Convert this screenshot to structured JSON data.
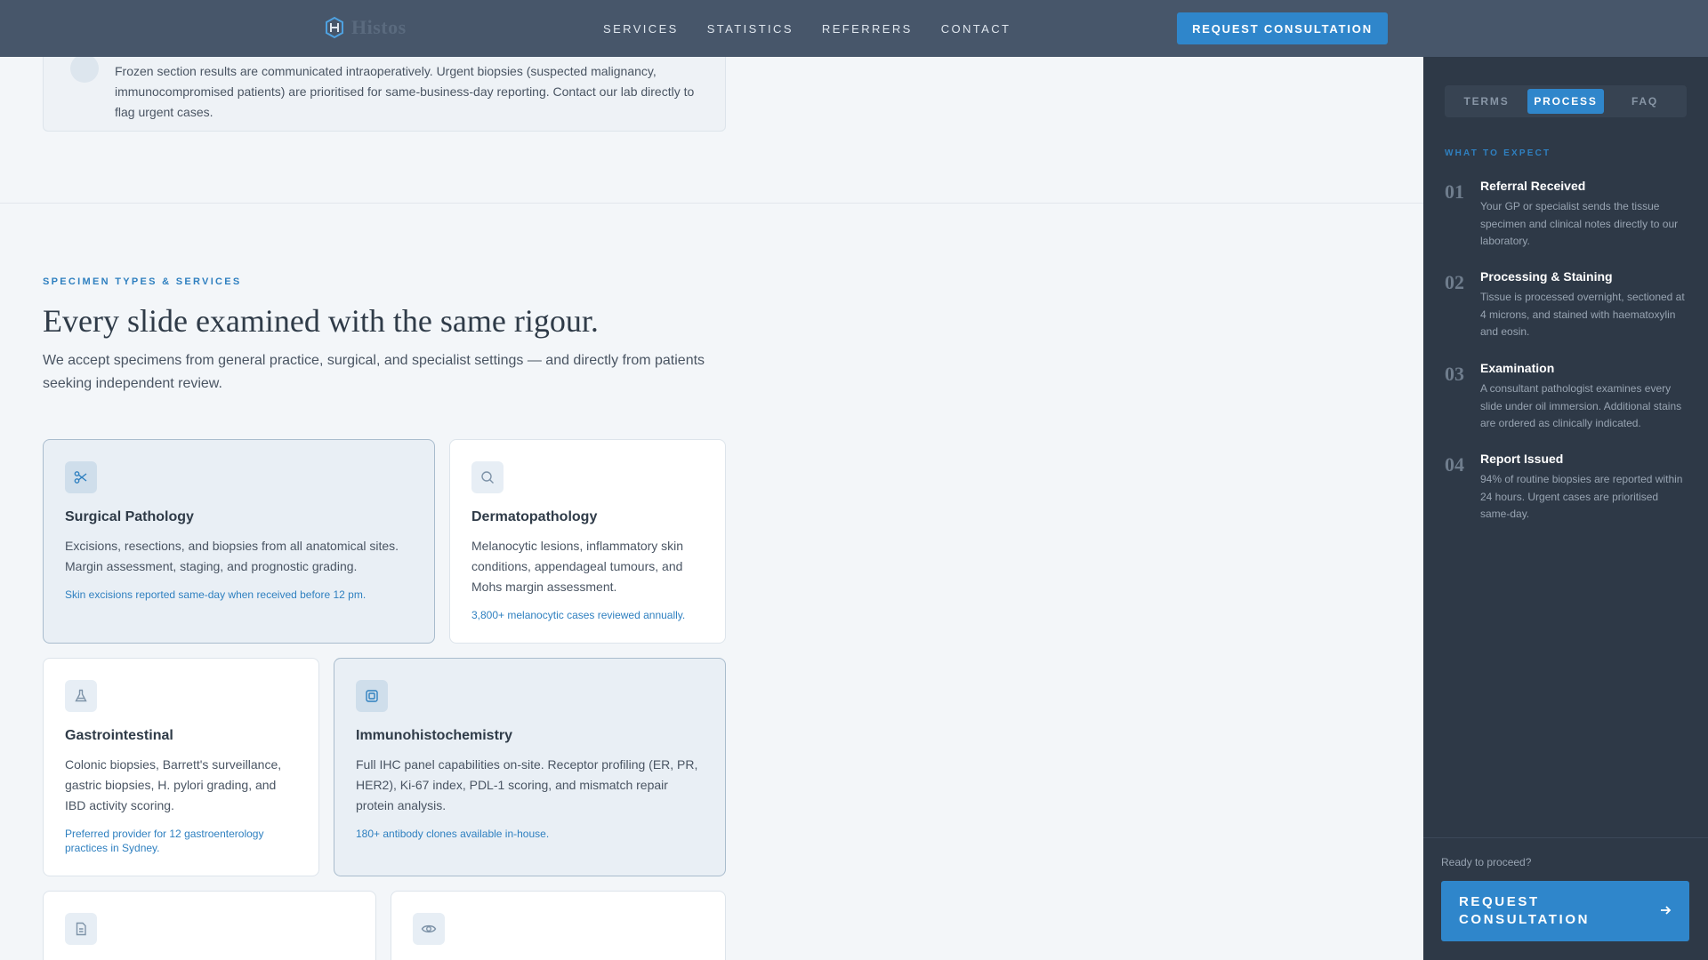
{
  "nav": {
    "brand": "Histos",
    "links": [
      "SERVICES",
      "STATISTICS",
      "REFERRERS",
      "CONTACT"
    ],
    "cta": "REQUEST CONSULTATION"
  },
  "previous": {
    "text": "Frozen section results are communicated intraoperatively. Urgent biopsies (suspected malignancy, immunocompromised patients) are prioritised for same-business-day reporting. Contact our lab directly to flag urgent cases."
  },
  "section": {
    "eyebrow": "SPECIMEN TYPES & SERVICES",
    "title": "Every slide examined with the same rigour.",
    "lede": "We accept specimens from general practice, surgical, and specialist settings — and directly from patients seeking independent review."
  },
  "services": [
    {
      "icon": "scissors-icon",
      "title": "Surgical Pathology",
      "desc": "Excisions, resections, and biopsies from all anatomical sites. Margin assessment, staging, and prognostic grading.",
      "note": "Skin excisions reported same-day when received before 12 pm."
    },
    {
      "icon": "search-icon",
      "title": "Dermatopathology",
      "desc": "Melanocytic lesions, inflammatory skin conditions, appendageal tumours, and Mohs margin assessment.",
      "note": "3,800+ melanocytic cases reviewed annually."
    },
    {
      "icon": "flask-icon",
      "title": "Gastrointestinal",
      "desc": "Colonic biopsies, Barrett's surveillance, gastric biopsies, H. pylori grading, and IBD activity scoring.",
      "note": "Preferred provider for 12 gastroenterology practices in Sydney."
    },
    {
      "icon": "chip-icon",
      "title": "Immunohistochemistry",
      "desc": "Full IHC panel capabilities on-site. Receptor profiling (ER, PR, HER2), Ki-67 index, PDL-1 scoring, and mismatch repair protein analysis.",
      "note": "180+ antibody clones available in-house."
    },
    {
      "icon": "document-icon"
    },
    {
      "icon": "eye-icon"
    }
  ],
  "sidebar": {
    "tabs": [
      "TERMS",
      "PROCESS",
      "FAQ"
    ],
    "active_tab": "PROCESS",
    "eyebrow": "WHAT TO EXPECT",
    "steps": [
      {
        "num": "01",
        "title": "Referral Received",
        "body": "Your GP or specialist sends the tissue specimen and clinical notes directly to our laboratory."
      },
      {
        "num": "02",
        "title": "Processing & Staining",
        "body": "Tissue is processed overnight, sectioned at 4 microns, and stained with haematoxylin and eosin."
      },
      {
        "num": "03",
        "title": "Examination",
        "body": "A consultant pathologist examines every slide under oil immersion. Additional stains are ordered as clinically indicated."
      },
      {
        "num": "04",
        "title": "Report Issued",
        "body": "94% of routine biopsies are reported within 24 hours. Urgent cases are prioritised same-day."
      }
    ],
    "ready": "Ready to proceed?",
    "cta": "REQUEST CONSULTATION"
  },
  "colors": {
    "accent": "#2f86cb",
    "nav_bg": "#47566a",
    "sidebar_bg": "#2e3947",
    "page_bg": "#f3f6f9"
  }
}
